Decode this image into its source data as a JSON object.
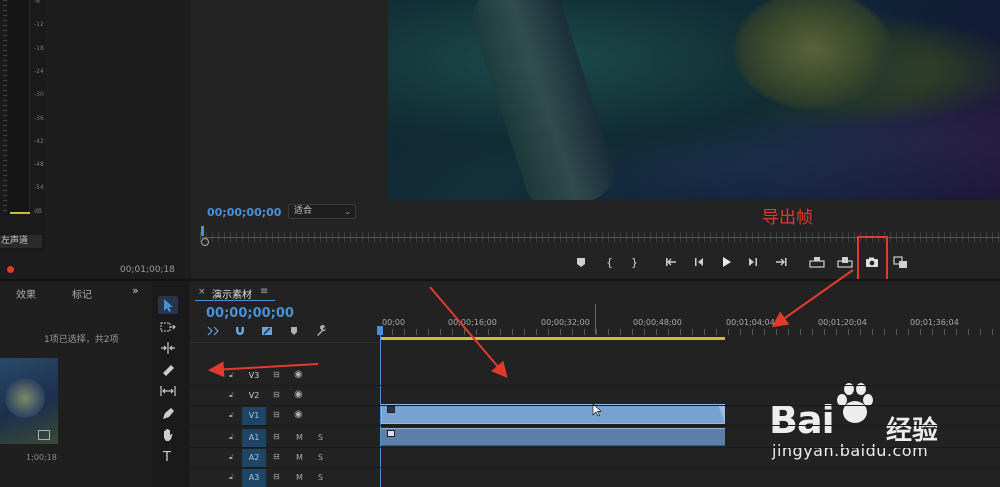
{
  "meter": {
    "ticks": [
      "-6",
      "-12",
      "-18",
      "-24",
      "-30",
      "-36",
      "-42",
      "-48",
      "-54",
      "dB"
    ],
    "lane_label": "左声道"
  },
  "program_monitor": {
    "timecode": "00;00;00;00",
    "fit_label": "适合",
    "annotation": "导出帧"
  },
  "source_panel": {
    "timecode": "00;01;00;18"
  },
  "project_panel": {
    "tab_effects": "效果",
    "tab_markers": "标记",
    "more": "»",
    "selection_info": "1项已选择，共2项",
    "thumb_duration": "1;00;18"
  },
  "timeline": {
    "tab_title": "演示素材",
    "tab_close": "×",
    "tab_menu": "≡",
    "timecode": "00;00;00;00",
    "ruler_labels": [
      "00;00",
      "00;00;16;00",
      "00;00;32;00",
      "00;00;48;00",
      "00;01;04;04",
      "00;01;20;04",
      "00;01;36;04"
    ],
    "tracks": [
      {
        "name": "V3",
        "kind": "video",
        "on": false
      },
      {
        "name": "V2",
        "kind": "video",
        "on": false
      },
      {
        "name": "V1",
        "kind": "video",
        "on": true
      },
      {
        "name": "A1",
        "kind": "audio",
        "on": true
      },
      {
        "name": "A2",
        "kind": "audio",
        "on": true
      },
      {
        "name": "A3",
        "kind": "audio",
        "on": true
      }
    ],
    "audio_m": "M",
    "audio_s": "S"
  },
  "watermark": {
    "bai": "Bai",
    "du": "du",
    "jingyan": "经验",
    "url": "jingyan.baidu.com"
  },
  "colors": {
    "accent_blue": "#4a90d9",
    "annotation_red": "#e33a2e",
    "work_area_yellow": "#c9c230",
    "clip_video": "#7aa2d0",
    "clip_audio": "#5b7fa6"
  }
}
